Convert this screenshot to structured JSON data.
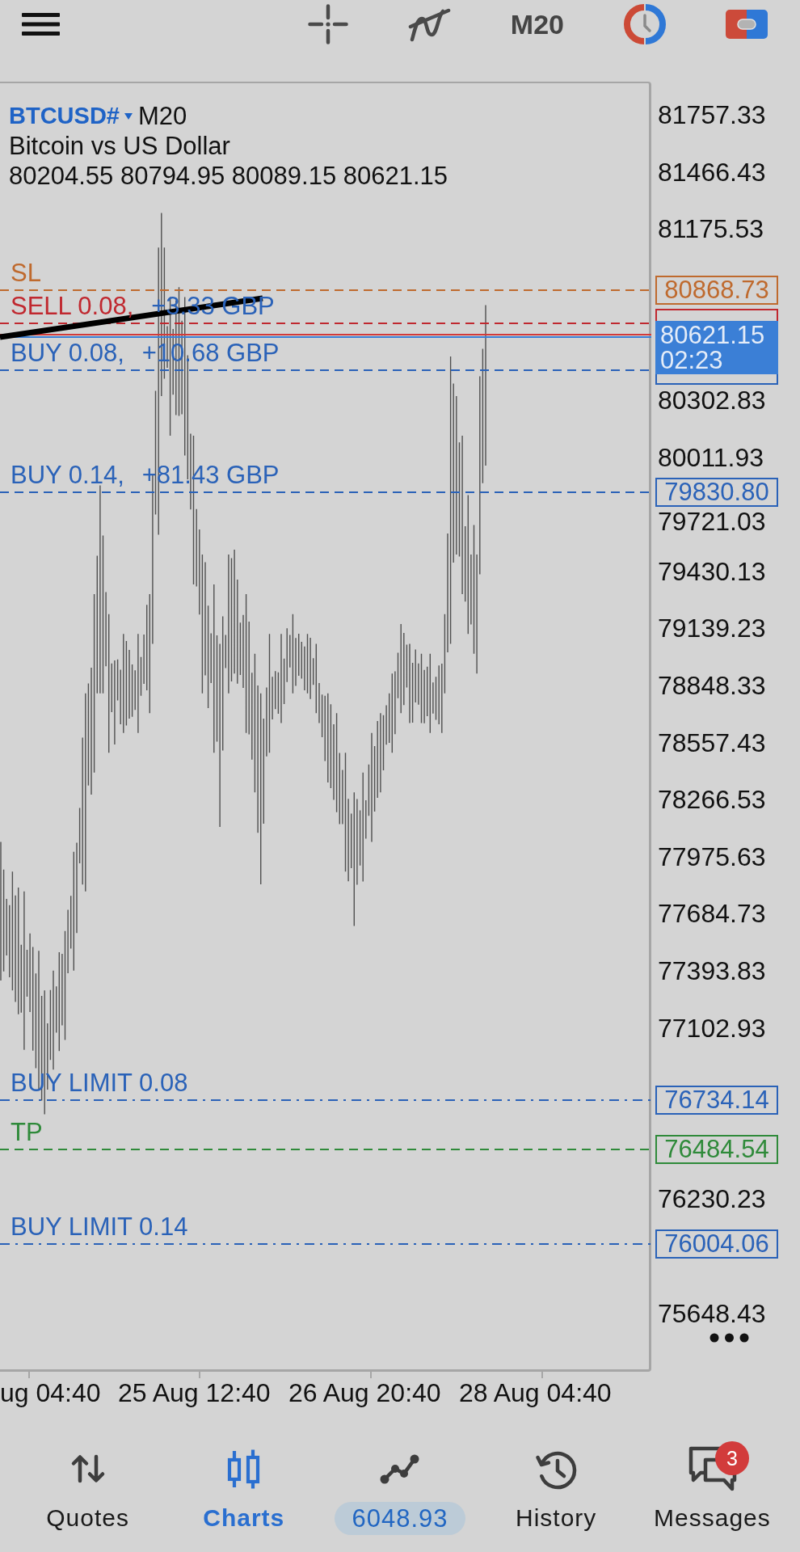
{
  "toolbar": {
    "timeframe": "M20"
  },
  "chart": {
    "symbol": "BTCUSD#",
    "timeframe": "M20",
    "description": "Bitcoin vs US Dollar",
    "ohlc": "80204.55 80794.95 80089.15 80621.15",
    "price_axis": [
      "81757.33",
      "81466.43",
      "81175.53",
      "80302.83",
      "80011.93",
      "79721.03",
      "79430.13",
      "79139.23",
      "78848.33",
      "78557.43",
      "78266.53",
      "77975.63",
      "77684.73",
      "77393.83",
      "77102.93",
      "76230.23",
      "75648.43"
    ],
    "current_price": {
      "price": "80621.15",
      "countdown": "02:23"
    },
    "order_lines": [
      {
        "kind": "sl",
        "label": "SL",
        "price": "80868.73"
      },
      {
        "kind": "sell",
        "label": "SELL 0.08,",
        "profit": "+3.33 GBP"
      },
      {
        "kind": "buy",
        "label": "BUY 0.08,",
        "profit": "+10.68 GBP"
      },
      {
        "kind": "buy",
        "label": "BUY 0.14,",
        "profit": "+81.43 GBP",
        "price": "79830.80"
      },
      {
        "kind": "buy_limit",
        "label": "BUY LIMIT 0.08",
        "price": "76734.14"
      },
      {
        "kind": "tp",
        "label": "TP",
        "price": "76484.54"
      },
      {
        "kind": "buy_limit",
        "label": "BUY LIMIT 0.14",
        "price": "76004.06"
      }
    ],
    "time_axis": [
      "ug 04:40",
      "25 Aug 12:40",
      "26 Aug 20:40",
      "28 Aug 04:40"
    ]
  },
  "bottom_nav": [
    {
      "kind": "tab",
      "label": "Quotes",
      "selected": false
    },
    {
      "kind": "tab",
      "label": "Charts",
      "selected": true
    },
    {
      "kind": "balance",
      "label": "6048.93",
      "selected": false
    },
    {
      "kind": "tab",
      "label": "History",
      "selected": false
    },
    {
      "kind": "tab",
      "label": "Messages",
      "selected": false,
      "badge": "3"
    }
  ]
}
